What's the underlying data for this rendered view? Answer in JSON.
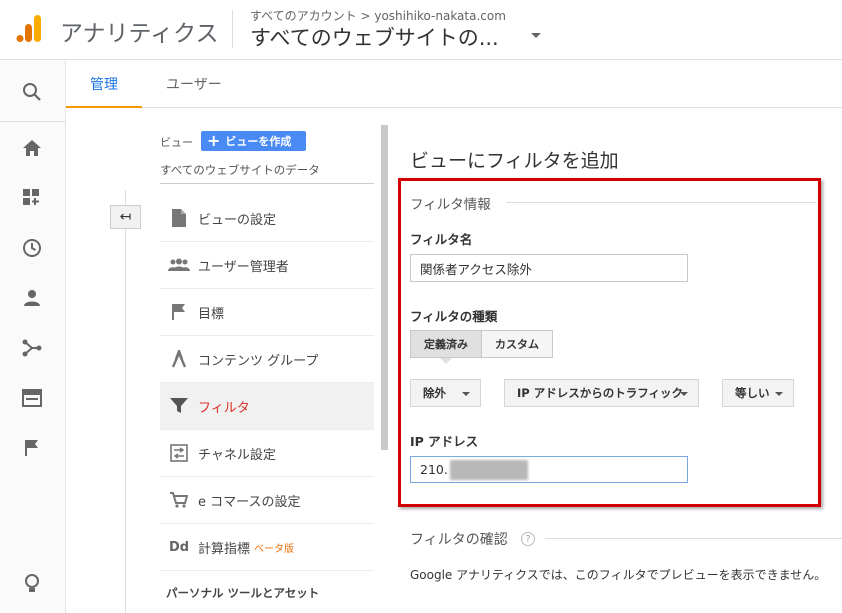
{
  "header": {
    "app_name": "アナリティクス",
    "account_line": "すべてのアカウント > yoshihiko-nakata.com",
    "property_line": "すべてのウェブサイトの..."
  },
  "rail": {
    "icons": [
      "search-icon",
      "home-icon",
      "dashboard-icon",
      "clock-icon",
      "person-icon",
      "share-icon",
      "browser-icon",
      "flag-icon",
      "lightbulb-icon"
    ]
  },
  "tabs": {
    "admin": "管理",
    "user": "ユーザー"
  },
  "view": {
    "label": "ビュー",
    "create_button": "ビューを作成",
    "name": "すべてのウェブサイトのデータ",
    "back_arrow": "↤"
  },
  "nav": {
    "items": [
      {
        "label": "ビューの設定",
        "icon": "document-icon"
      },
      {
        "label": "ユーザー管理者",
        "icon": "people-icon"
      },
      {
        "label": "目標",
        "icon": "flag-icon"
      },
      {
        "label": "コンテンツ グループ",
        "icon": "content-group-icon"
      },
      {
        "label": "フィルタ",
        "icon": "filter-icon"
      },
      {
        "label": "チャネル設定",
        "icon": "channel-icon"
      },
      {
        "label": "e コマースの設定",
        "icon": "cart-icon"
      },
      {
        "label": "計算指標",
        "icon": "dd-icon",
        "badge": "ベータ版"
      }
    ],
    "icon_dd_text": "Dd",
    "section_title": "パーソナル ツールとアセット"
  },
  "form": {
    "page_title": "ビューにフィルタを追加",
    "section_header": "フィルタ情報",
    "filter_name_label": "フィルタ名",
    "filter_name_value": "関係者アクセス除外",
    "filter_type_label": "フィルタの種類",
    "type_predefined": "定義済み",
    "type_custom": "カスタム",
    "dropdown_type": "除外",
    "dropdown_field": "IP アドレスからのトラフィック",
    "dropdown_operator": "等しい",
    "ip_label": "IP アドレス",
    "ip_value": "210."
  },
  "verify": {
    "title": "フィルタの確認",
    "help": "?",
    "text": "Google アナリティクスでは、このフィルタでプレビューを表示できません。"
  },
  "colors": {
    "accent": "#1a73e8",
    "tab_underline": "#f29900",
    "active_red": "#d93025",
    "highlight_box": "#d20000"
  }
}
